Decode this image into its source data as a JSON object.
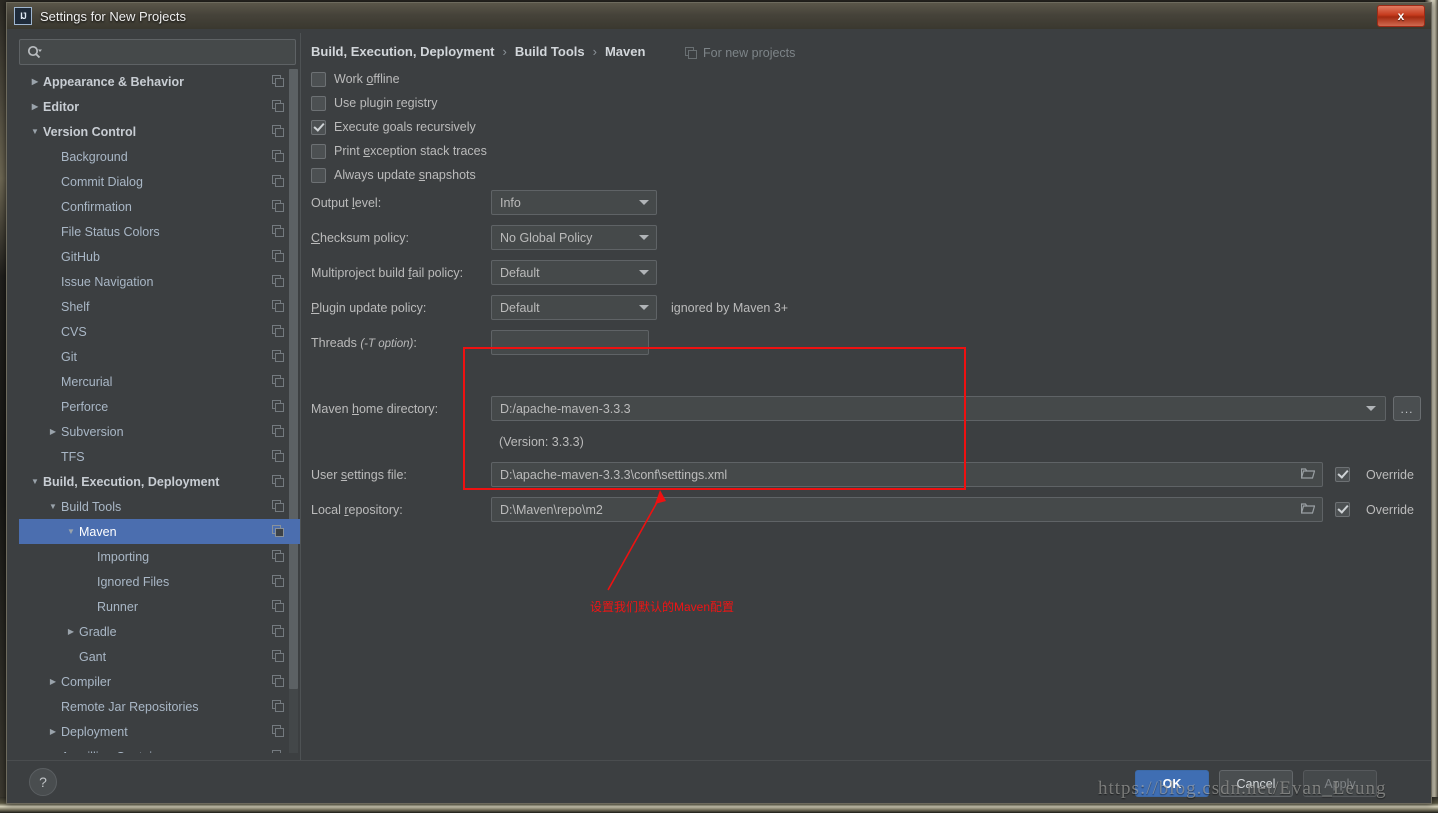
{
  "window": {
    "title": "Settings for New Projects",
    "icon": "intellij-idea-icon",
    "close_label": "x"
  },
  "search": {
    "value": "",
    "placeholder": ""
  },
  "sidebar": {
    "items": [
      {
        "label": "Appearance & Behavior",
        "level": 0,
        "arrow": "collapsed",
        "bold": true,
        "selected": false
      },
      {
        "label": "Editor",
        "level": 0,
        "arrow": "collapsed",
        "bold": true,
        "selected": false
      },
      {
        "label": "Version Control",
        "level": 0,
        "arrow": "expanded",
        "bold": true,
        "selected": false
      },
      {
        "label": "Background",
        "level": 1,
        "arrow": "none",
        "bold": false,
        "selected": false
      },
      {
        "label": "Commit Dialog",
        "level": 1,
        "arrow": "none",
        "bold": false,
        "selected": false
      },
      {
        "label": "Confirmation",
        "level": 1,
        "arrow": "none",
        "bold": false,
        "selected": false
      },
      {
        "label": "File Status Colors",
        "level": 1,
        "arrow": "none",
        "bold": false,
        "selected": false
      },
      {
        "label": "GitHub",
        "level": 1,
        "arrow": "none",
        "bold": false,
        "selected": false
      },
      {
        "label": "Issue Navigation",
        "level": 1,
        "arrow": "none",
        "bold": false,
        "selected": false
      },
      {
        "label": "Shelf",
        "level": 1,
        "arrow": "none",
        "bold": false,
        "selected": false
      },
      {
        "label": "CVS",
        "level": 1,
        "arrow": "none",
        "bold": false,
        "selected": false
      },
      {
        "label": "Git",
        "level": 1,
        "arrow": "none",
        "bold": false,
        "selected": false
      },
      {
        "label": "Mercurial",
        "level": 1,
        "arrow": "none",
        "bold": false,
        "selected": false
      },
      {
        "label": "Perforce",
        "level": 1,
        "arrow": "none",
        "bold": false,
        "selected": false
      },
      {
        "label": "Subversion",
        "level": 1,
        "arrow": "collapsed",
        "bold": false,
        "selected": false
      },
      {
        "label": "TFS",
        "level": 1,
        "arrow": "none",
        "bold": false,
        "selected": false
      },
      {
        "label": "Build, Execution, Deployment",
        "level": 0,
        "arrow": "expanded",
        "bold": true,
        "selected": false
      },
      {
        "label": "Build Tools",
        "level": 1,
        "arrow": "expanded",
        "bold": false,
        "selected": false
      },
      {
        "label": "Maven",
        "level": 2,
        "arrow": "expanded",
        "bold": false,
        "selected": true
      },
      {
        "label": "Importing",
        "level": 3,
        "arrow": "none",
        "bold": false,
        "selected": false
      },
      {
        "label": "Ignored Files",
        "level": 3,
        "arrow": "none",
        "bold": false,
        "selected": false
      },
      {
        "label": "Runner",
        "level": 3,
        "arrow": "none",
        "bold": false,
        "selected": false
      },
      {
        "label": "Gradle",
        "level": 2,
        "arrow": "collapsed",
        "bold": false,
        "selected": false
      },
      {
        "label": "Gant",
        "level": 2,
        "arrow": "none",
        "bold": false,
        "selected": false
      },
      {
        "label": "Compiler",
        "level": 1,
        "arrow": "collapsed",
        "bold": false,
        "selected": false
      },
      {
        "label": "Remote Jar Repositories",
        "level": 1,
        "arrow": "none",
        "bold": false,
        "selected": false
      },
      {
        "label": "Deployment",
        "level": 1,
        "arrow": "collapsed",
        "bold": false,
        "selected": false
      },
      {
        "label": "Arquillian Containers",
        "level": 1,
        "arrow": "none",
        "bold": false,
        "selected": false
      }
    ]
  },
  "breadcrumb": {
    "part1": "Build, Execution, Deployment",
    "sep1": "›",
    "part2": "Build Tools",
    "sep2": "›",
    "part3": "Maven",
    "for_new_projects": "For new projects"
  },
  "checkboxes": [
    {
      "label_pre": "Work ",
      "mnemonic": "o",
      "label_post": "ffline",
      "checked": false
    },
    {
      "label_pre": "Use plugin ",
      "mnemonic": "r",
      "label_post": "egistry",
      "checked": false
    },
    {
      "label_pre": "Execute ",
      "mnemonic": "g",
      "label_post": "oals recursively",
      "checked": true
    },
    {
      "label_pre": "Print ",
      "mnemonic": "e",
      "label_post": "xception stack traces",
      "checked": false
    },
    {
      "label_pre": "Always update ",
      "mnemonic": "s",
      "label_post": "napshots",
      "checked": false
    }
  ],
  "fields": {
    "output_level": {
      "label_pre": "Output ",
      "mnemonic": "l",
      "label_post": "evel:",
      "value": "Info"
    },
    "checksum": {
      "label_pre": "",
      "mnemonic": "C",
      "label_post": "hecksum policy:",
      "value": "No Global Policy"
    },
    "multiproject": {
      "label_pre": "Multiproject build ",
      "mnemonic": "f",
      "label_post": "ail policy:",
      "value": "Default"
    },
    "plugin_update": {
      "label_pre": "",
      "mnemonic": "P",
      "label_post": "lugin update policy:",
      "value": "Default",
      "note": "ignored by Maven 3+"
    },
    "threads": {
      "label_pre": "Threads ",
      "italic": "(-T option)",
      "label_post": ":",
      "value": ""
    }
  },
  "paths": {
    "maven_home": {
      "label_pre": "Maven ",
      "mnemonic": "h",
      "label_post": "ome directory:",
      "value": "D:/apache-maven-3.3.3"
    },
    "version_text": "(Version: 3.3.3)",
    "user_settings": {
      "label_pre": "User ",
      "mnemonic": "s",
      "label_post": "ettings file:",
      "value": "D:\\apache-maven-3.3.3\\conf\\settings.xml",
      "override_label": "Override",
      "override_checked": true
    },
    "local_repo": {
      "label_pre": "Local ",
      "mnemonic": "r",
      "label_post": "epository:",
      "value": "D:\\Maven\\repo\\m2",
      "override_label": "Override",
      "override_checked": true
    },
    "browse_label": "..."
  },
  "annotation": {
    "text": "设置我们默认的Maven配置",
    "color": "#ee1111"
  },
  "footer": {
    "help_label": "?",
    "ok_label": "OK",
    "cancel_label": "Cancel",
    "apply_label": "Apply"
  },
  "watermark": {
    "text": "https://blog.csdn.net/Evan_Leung"
  }
}
